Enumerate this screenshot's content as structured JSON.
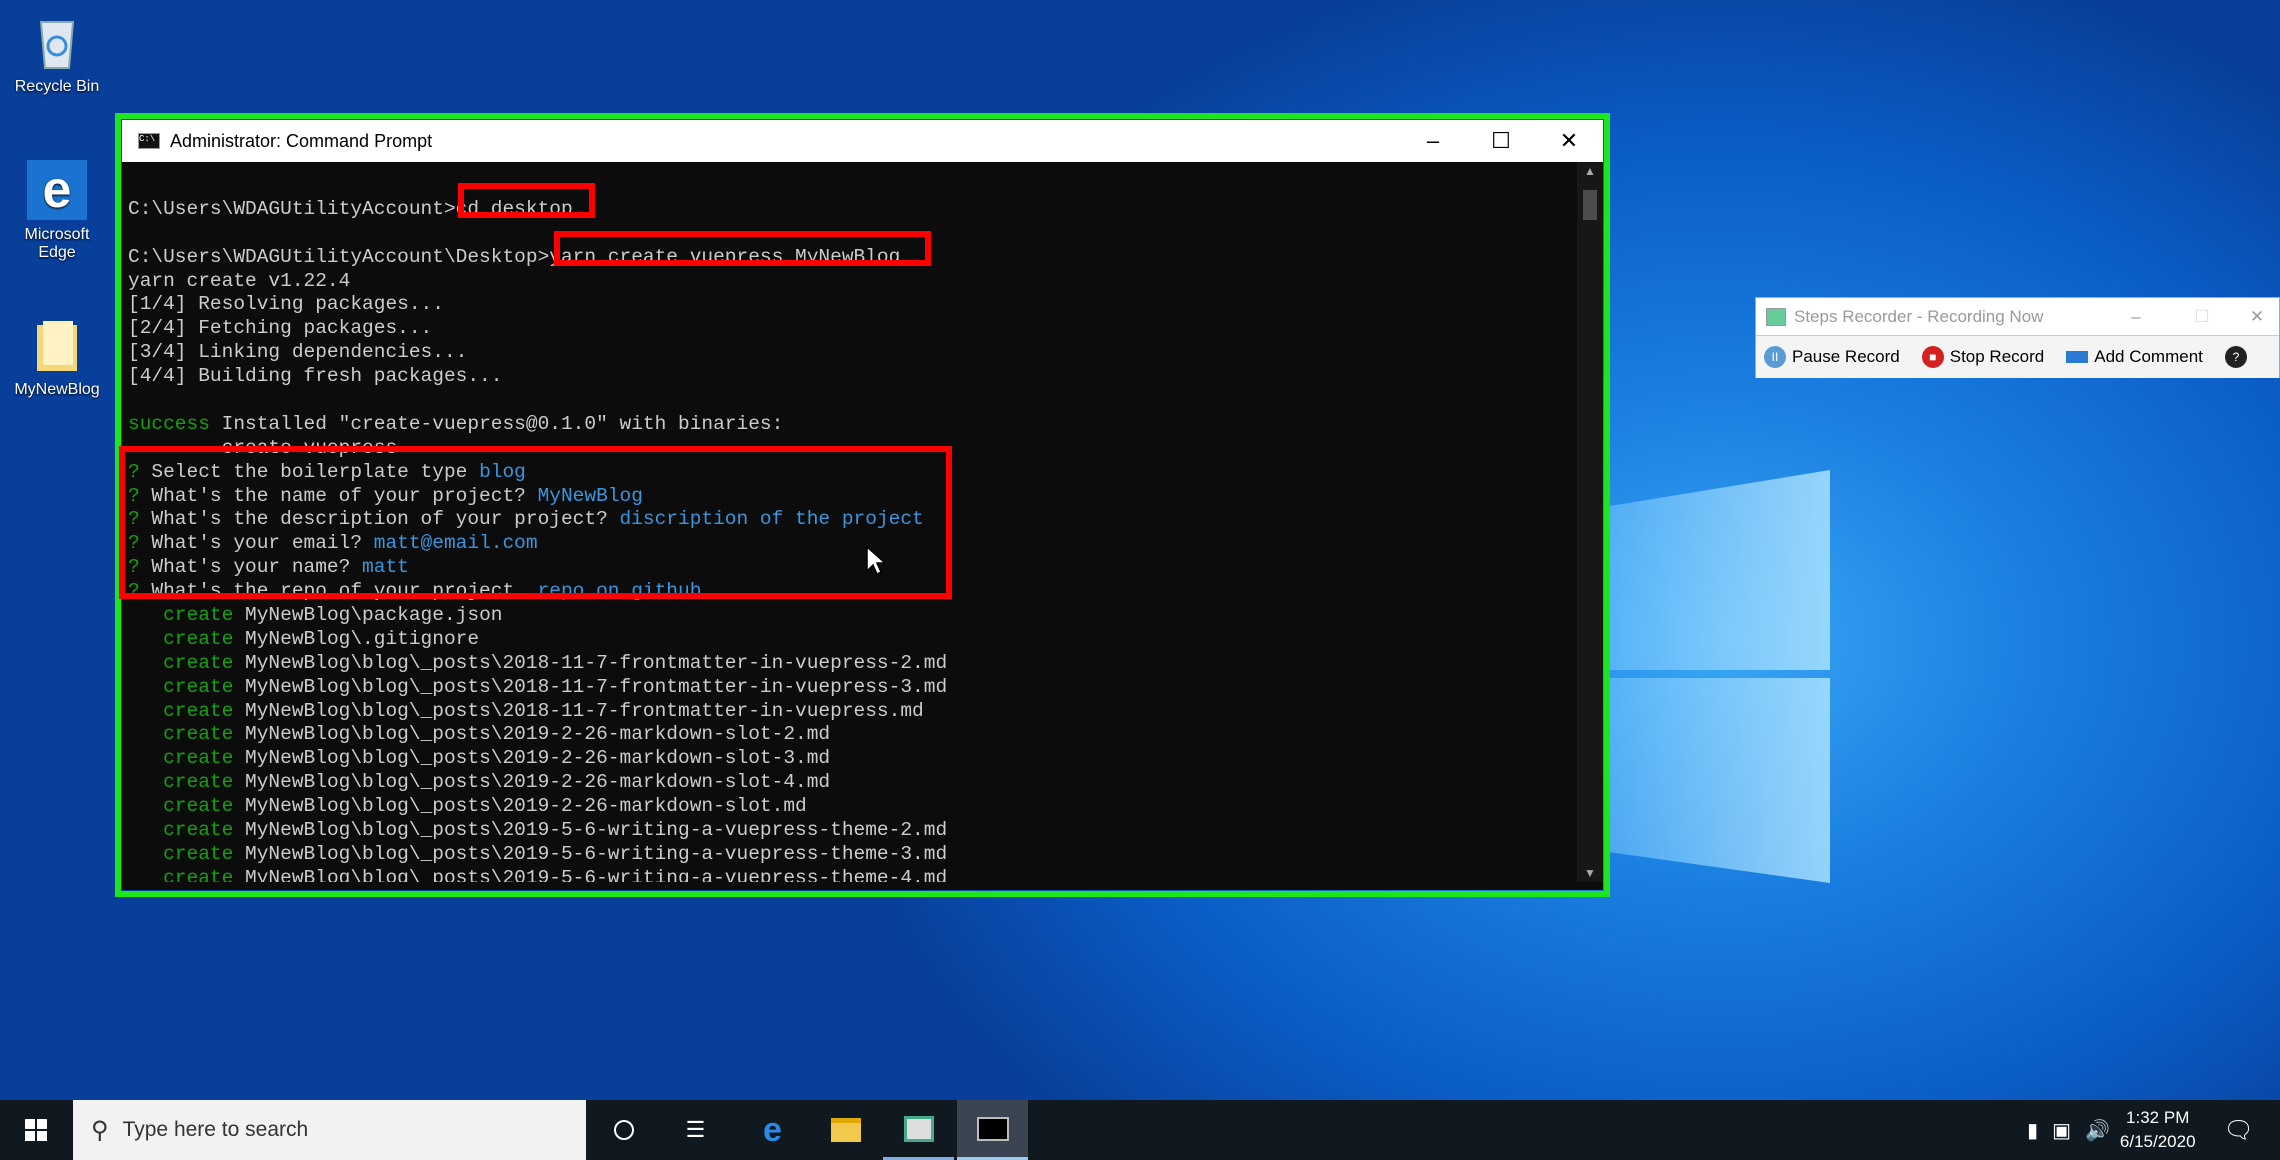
{
  "desktop": {
    "icons": [
      {
        "label": "Recycle Bin",
        "icon": "recycle-bin-icon"
      },
      {
        "label": "Microsoft Edge",
        "icon": "edge-icon"
      },
      {
        "label": "MyNewBlog",
        "icon": "folder-icon"
      }
    ]
  },
  "cmd": {
    "title": "Administrator: Command Prompt",
    "colors": {
      "text": "#cccccc",
      "green": "#13a10e",
      "blue": "#3a96dd",
      "highlight_box": "#ff0000",
      "frame": "#1ee61e"
    },
    "lines": [
      [],
      [
        {
          "t": "C:\\Users\\WDAGUtilityAccount>",
          "c": "white"
        },
        {
          "t": "cd desktop",
          "c": "white"
        }
      ],
      [],
      [
        {
          "t": "C:\\Users\\WDAGUtilityAccount\\Desktop>",
          "c": "white"
        },
        {
          "t": "yarn create vuepress MyNewBlog",
          "c": "white"
        }
      ],
      [
        {
          "t": "yarn create v1.22.4",
          "c": "white"
        }
      ],
      [
        {
          "t": "[1/4] Resolving packages...",
          "c": "white"
        }
      ],
      [
        {
          "t": "[2/4] Fetching packages...",
          "c": "white"
        }
      ],
      [
        {
          "t": "[3/4] Linking dependencies...",
          "c": "white"
        }
      ],
      [
        {
          "t": "[4/4] Building fresh packages...",
          "c": "white"
        }
      ],
      [],
      [
        {
          "t": "success",
          "c": "green"
        },
        {
          "t": " Installed \"create-vuepress@0.1.0\" with binaries:",
          "c": "white"
        }
      ],
      [
        {
          "t": "      - create-vuepress",
          "c": "white"
        }
      ],
      [
        {
          "t": "?",
          "c": "green"
        },
        {
          "t": " Select the boilerplate type ",
          "c": "white"
        },
        {
          "t": "blog",
          "c": "blue"
        }
      ],
      [
        {
          "t": "?",
          "c": "green"
        },
        {
          "t": " What's the name of your project? ",
          "c": "white"
        },
        {
          "t": "MyNewBlog",
          "c": "blue"
        }
      ],
      [
        {
          "t": "?",
          "c": "green"
        },
        {
          "t": " What's the description of your project? ",
          "c": "white"
        },
        {
          "t": "discription of the project",
          "c": "blue"
        }
      ],
      [
        {
          "t": "?",
          "c": "green"
        },
        {
          "t": " What's your email? ",
          "c": "white"
        },
        {
          "t": "matt@email.com",
          "c": "blue"
        }
      ],
      [
        {
          "t": "?",
          "c": "green"
        },
        {
          "t": " What's your name? ",
          "c": "white"
        },
        {
          "t": "matt",
          "c": "blue"
        }
      ],
      [
        {
          "t": "?",
          "c": "green"
        },
        {
          "t": " What's the repo of your project. ",
          "c": "white"
        },
        {
          "t": "repo on github",
          "c": "blue"
        }
      ],
      [
        {
          "t": "   create",
          "c": "green"
        },
        {
          "t": " MyNewBlog\\package.json",
          "c": "white"
        }
      ],
      [
        {
          "t": "   create",
          "c": "green"
        },
        {
          "t": " MyNewBlog\\.gitignore",
          "c": "white"
        }
      ],
      [
        {
          "t": "   create",
          "c": "green"
        },
        {
          "t": " MyNewBlog\\blog\\_posts\\2018-11-7-frontmatter-in-vuepress-2.md",
          "c": "white"
        }
      ],
      [
        {
          "t": "   create",
          "c": "green"
        },
        {
          "t": " MyNewBlog\\blog\\_posts\\2018-11-7-frontmatter-in-vuepress-3.md",
          "c": "white"
        }
      ],
      [
        {
          "t": "   create",
          "c": "green"
        },
        {
          "t": " MyNewBlog\\blog\\_posts\\2018-11-7-frontmatter-in-vuepress.md",
          "c": "white"
        }
      ],
      [
        {
          "t": "   create",
          "c": "green"
        },
        {
          "t": " MyNewBlog\\blog\\_posts\\2019-2-26-markdown-slot-2.md",
          "c": "white"
        }
      ],
      [
        {
          "t": "   create",
          "c": "green"
        },
        {
          "t": " MyNewBlog\\blog\\_posts\\2019-2-26-markdown-slot-3.md",
          "c": "white"
        }
      ],
      [
        {
          "t": "   create",
          "c": "green"
        },
        {
          "t": " MyNewBlog\\blog\\_posts\\2019-2-26-markdown-slot-4.md",
          "c": "white"
        }
      ],
      [
        {
          "t": "   create",
          "c": "green"
        },
        {
          "t": " MyNewBlog\\blog\\_posts\\2019-2-26-markdown-slot.md",
          "c": "white"
        }
      ],
      [
        {
          "t": "   create",
          "c": "green"
        },
        {
          "t": " MyNewBlog\\blog\\_posts\\2019-5-6-writing-a-vuepress-theme-2.md",
          "c": "white"
        }
      ],
      [
        {
          "t": "   create",
          "c": "green"
        },
        {
          "t": " MyNewBlog\\blog\\_posts\\2019-5-6-writing-a-vuepress-theme-3.md",
          "c": "white"
        }
      ],
      [
        {
          "t": "   create",
          "c": "green"
        },
        {
          "t": " MyNewBlog\\blog\\_posts\\2019-5-6-writing-a-vuepress-theme-4.md",
          "c": "white"
        }
      ]
    ]
  },
  "steps_recorder": {
    "title": "Steps Recorder - Recording Now",
    "pause": "Pause Record",
    "stop": "Stop Record",
    "comment": "Add Comment",
    "help": "?"
  },
  "taskbar": {
    "search_placeholder": "Type here to search",
    "time": "1:32 PM",
    "date": "6/15/2020"
  }
}
